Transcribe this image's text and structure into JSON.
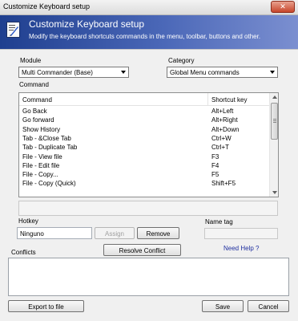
{
  "window": {
    "title": "Customize Keyboard setup",
    "close_label": "✕"
  },
  "header": {
    "title": "Customize Keyboard setup",
    "subtitle": "Modify the keyboard shortcuts commands in the menu, toolbar, buttons and other."
  },
  "module": {
    "label": "Module",
    "selected": "Multi Commander (Base)"
  },
  "category": {
    "label": "Category",
    "selected": "Global Menu commands"
  },
  "command_list": {
    "label": "Command",
    "columns": [
      "Command",
      "Shortcut key"
    ],
    "rows": [
      {
        "command": "Go Back",
        "shortcut": "Alt+Left"
      },
      {
        "command": "Go forward",
        "shortcut": "Alt+Right"
      },
      {
        "command": "Show History",
        "shortcut": "Alt+Down"
      },
      {
        "command": "Tab - &Close Tab",
        "shortcut": "Ctrl+W"
      },
      {
        "command": "Tab - Duplicate Tab",
        "shortcut": "Ctrl+T"
      },
      {
        "command": "File - View file",
        "shortcut": "F3"
      },
      {
        "command": "File - Edit file",
        "shortcut": "F4"
      },
      {
        "command": "File - Copy...",
        "shortcut": "F5"
      },
      {
        "command": "File - Copy (Quick)",
        "shortcut": "Shift+F5"
      }
    ]
  },
  "hotkey": {
    "label": "Hotkey",
    "value": "Ninguno",
    "assign_label": "Assign",
    "remove_label": "Remove"
  },
  "name_tag": {
    "label": "Name tag",
    "value": ""
  },
  "need_help_label": "Need Help ?",
  "conflicts": {
    "label": "Conflicts",
    "resolve_label": "Resolve Conflict"
  },
  "footer": {
    "export_label": "Export to file",
    "save_label": "Save",
    "cancel_label": "Cancel"
  },
  "colors": {
    "header_start": "#1f3f8f",
    "header_end": "#7b8fd0",
    "link": "#1f2f9f",
    "close_button": "#c7462b"
  }
}
